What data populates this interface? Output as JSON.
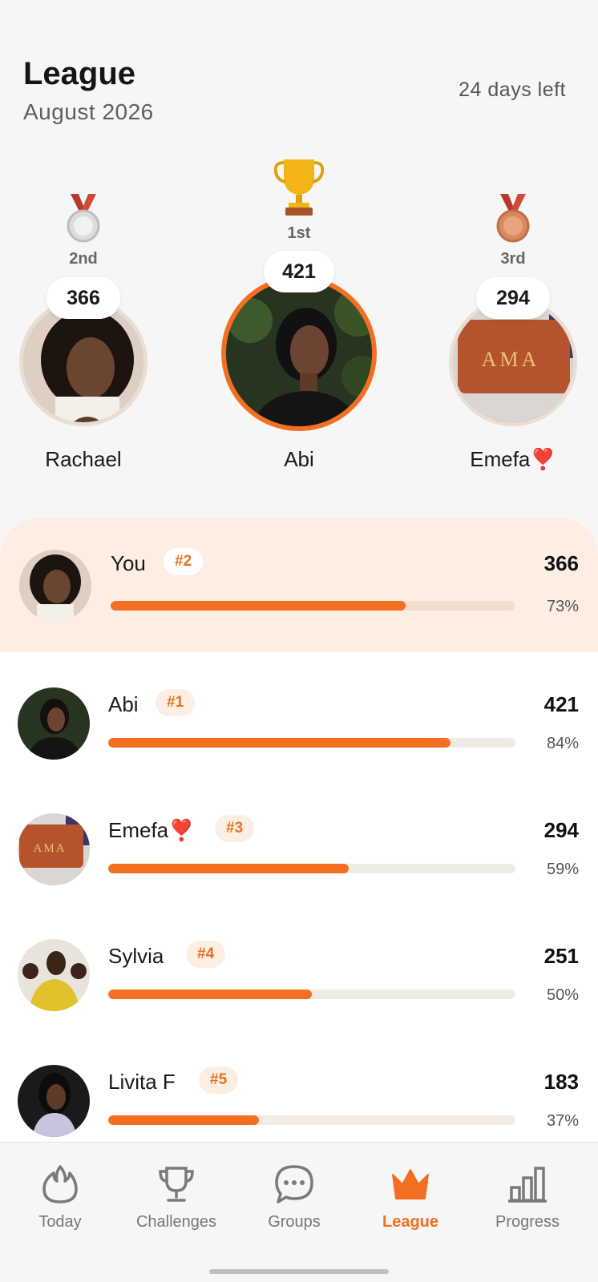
{
  "header": {
    "title": "League",
    "subtitle": "August 2026",
    "days_left": "24 days left"
  },
  "podium": {
    "first": {
      "place": "1st",
      "score": "421",
      "name": "Abi",
      "icon": "trophy-icon"
    },
    "second": {
      "place": "2nd",
      "score": "366",
      "name": "Rachael",
      "icon": "silver-medal-icon"
    },
    "third": {
      "place": "3rd",
      "score": "294",
      "name": "Emefa❣️",
      "icon": "bronze-medal-icon"
    }
  },
  "list": {
    "me": {
      "name": "You",
      "rank": "#2",
      "score": "366",
      "pct": "73%",
      "progress": 0.73
    },
    "rows": [
      {
        "name": "Abi",
        "rank": "#1",
        "score": "421",
        "pct": "84%",
        "progress": 0.84
      },
      {
        "name": "Emefa❣️",
        "rank": "#3",
        "score": "294",
        "pct": "59%",
        "progress": 0.59
      },
      {
        "name": "Sylvia",
        "rank": "#4",
        "score": "251",
        "pct": "50%",
        "progress": 0.5
      },
      {
        "name": "Livita F",
        "rank": "#5",
        "score": "183",
        "pct": "37%",
        "progress": 0.37
      }
    ]
  },
  "tabbar": {
    "items": [
      {
        "label": "Today",
        "icon": "flame-icon"
      },
      {
        "label": "Challenges",
        "icon": "trophy-outline-icon"
      },
      {
        "label": "Groups",
        "icon": "chat-bubble-icon"
      },
      {
        "label": "League",
        "icon": "crown-icon",
        "active": true
      },
      {
        "label": "Progress",
        "icon": "bar-chart-icon"
      }
    ]
  },
  "colors": {
    "accent": "#f36f21",
    "highlight_row": "#fdede2",
    "badge_bg": "#fdeee4",
    "badge_text": "#e8711f"
  }
}
